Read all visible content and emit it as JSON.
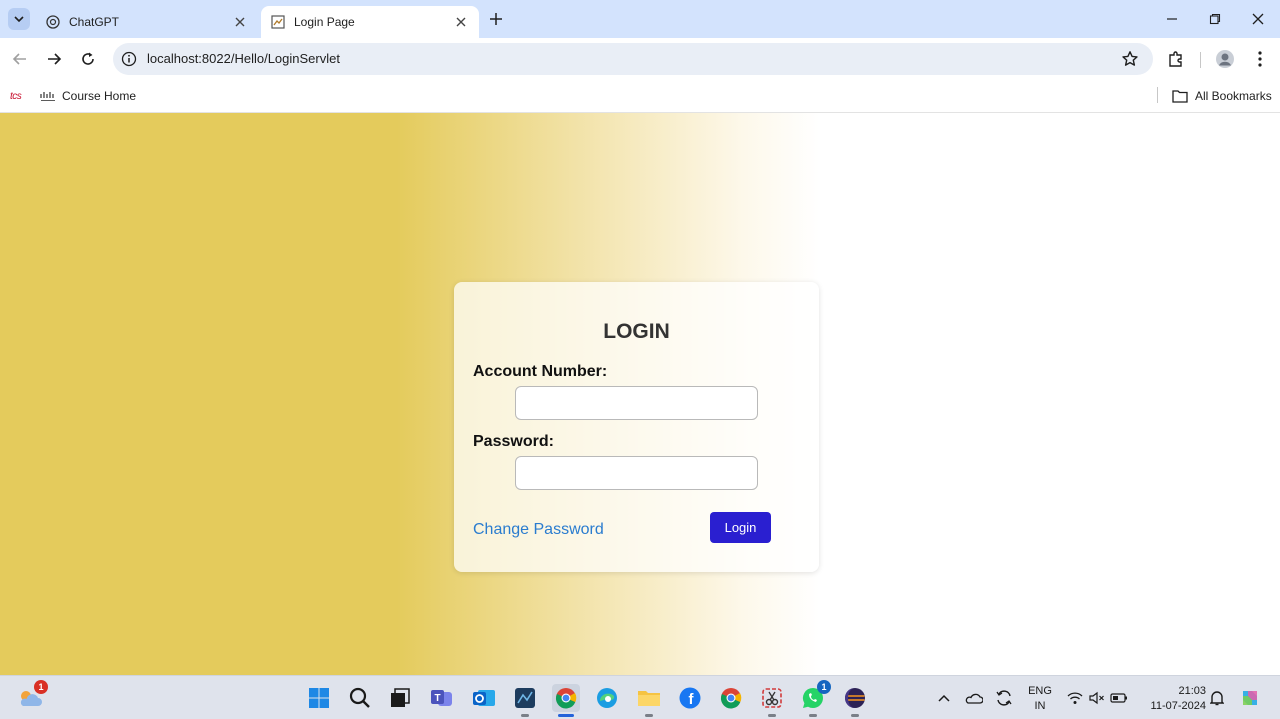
{
  "browser": {
    "tabs": [
      {
        "title": "ChatGPT",
        "icon": "chatgpt-icon",
        "active": false
      },
      {
        "title": "Login Page",
        "icon": "page-icon",
        "active": true
      }
    ],
    "url": "localhost:8022/Hello/LoginServlet",
    "bookmarks": [
      {
        "label": "tcs",
        "icon": "tcs-logo"
      },
      {
        "label": "Course Home",
        "icon": "cisco-logo"
      }
    ],
    "all_bookmarks_label": "All Bookmarks"
  },
  "login": {
    "title": "LOGIN",
    "account_label": "Account Number:",
    "account_value": "",
    "password_label": "Password:",
    "password_value": "",
    "change_password_label": "Change Password",
    "login_button_label": "Login"
  },
  "taskbar": {
    "weather_badge": "1",
    "whatsapp_badge": "1",
    "language": "ENG",
    "region": "IN",
    "time": "21:03",
    "date": "11-07-2024"
  },
  "colors": {
    "login_button": "#2a1fd0",
    "link": "#2a7ccf",
    "page_gradient_start": "#e4cb5c",
    "tab_strip": "#d3e3fd"
  }
}
